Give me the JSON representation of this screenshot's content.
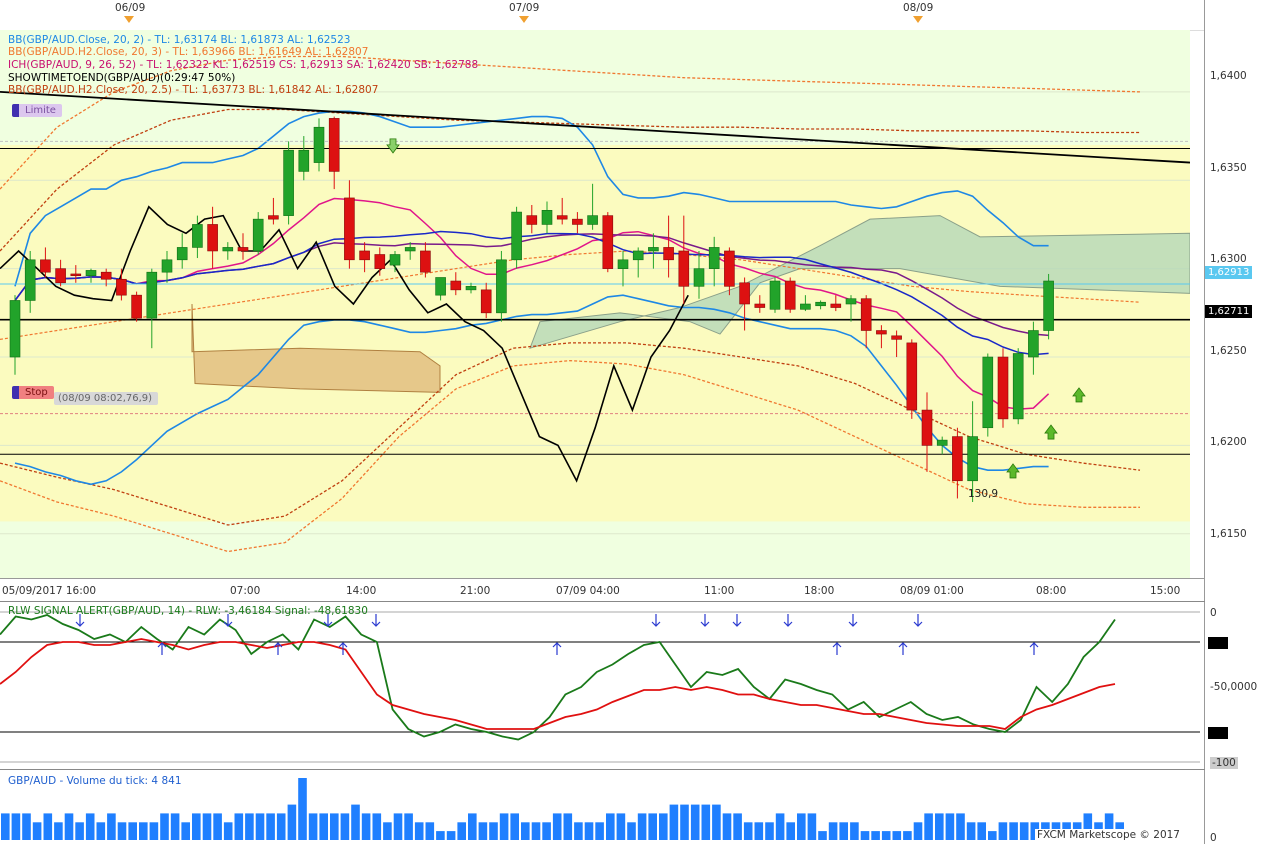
{
  "colors": {
    "bg_pane": "#f0ffe0",
    "band_yellow": "#fbfbbf",
    "up": "#22a32a",
    "down": "#dd1111",
    "bb_blue": "#1e88e5",
    "bb_orange": "#f07830",
    "bb_darkorange": "#c04010",
    "ich_mag": "#e0158a",
    "ich_purple": "#7a1a8a",
    "ich_blue": "#1a28c8",
    "kumo_green": "#b8d9b8",
    "kumo_orange": "#e6c88a",
    "showtime_black": "#000000",
    "rlw_green": "#1a7a1a",
    "rlw_red": "#e01010",
    "vol_blue": "#1f7fff"
  },
  "header_dates": [
    "06/09",
    "07/09",
    "08/09"
  ],
  "legend": [
    {
      "text": "BB(GBP/AUD.Close, 20, 2) -  TL: 1,63174  BL: 1,61873  AL: 1,62523",
      "color": "#1e88e5"
    },
    {
      "text": "BB(GBP/AUD.H2.Close, 20, 3) -  TL: 1,63966  BL: 1,61649  AL: 1,62807",
      "color": "#f07830"
    },
    {
      "text": "ICH(GBP/AUD, 9, 26, 52) -  TL: 1,62322  KL: 1,62519  CS: 1,62913  SA: 1,62420  SB: 1,62788",
      "color": "#c81070"
    },
    {
      "text": "SHOWTIMETOEND(GBP/AUD)(0:29:47 50%)",
      "color": "#000000"
    },
    {
      "text": "BB(GBP/AUD.H2.Close, 20, 2.5) -  TL: 1,63773  BL: 1,61842  AL: 1,62807",
      "color": "#c04010"
    }
  ],
  "badges": {
    "limite": "Limite",
    "stop": "Stop",
    "stop_note": "(08/09 08:02,76,9)"
  },
  "annotation_value": "130,9",
  "price_axis": [
    "1,6400",
    "1,6350",
    "1,6300",
    "1,6250",
    "1,6200",
    "1,6150"
  ],
  "price_boxes": {
    "current": "1,62913",
    "line": "1,62711"
  },
  "time_axis": [
    "05/09/2017 16:00",
    "07:00",
    "14:00",
    "21:00",
    "07/09 04:00",
    "11:00",
    "18:00",
    "08/09 01:00",
    "08:00",
    "15:00"
  ],
  "rlw": {
    "title": "RLW SIGNAL ALERT(GBP/AUD, 14) -  RLW: -3,46184  Signal: -48,61830",
    "axis": [
      "0",
      "-50,0000",
      "-100"
    ]
  },
  "volume": {
    "title": "GBP/AUD - Volume du tick: 4 841",
    "axis": [
      "0"
    ]
  },
  "copyright": "FXCM Marketscope © 2017",
  "chart_data": [
    {
      "type": "candlestick",
      "title": "GBP/AUD",
      "ylim": [
        1.6125,
        1.6435
      ],
      "x_tick_labels": [
        "05/09/2017 16:00",
        "07:00",
        "14:00",
        "21:00",
        "07/09 04:00",
        "11:00",
        "18:00",
        "08/09 01:00",
        "08:00",
        "15:00"
      ],
      "candles": [
        {
          "o": 1.625,
          "h": 1.6285,
          "l": 1.624,
          "c": 1.6282
        },
        {
          "o": 1.6282,
          "h": 1.631,
          "l": 1.6275,
          "c": 1.6305
        },
        {
          "o": 1.6305,
          "h": 1.6312,
          "l": 1.6295,
          "c": 1.6298
        },
        {
          "o": 1.63,
          "h": 1.6305,
          "l": 1.629,
          "c": 1.6292
        },
        {
          "o": 1.6297,
          "h": 1.6302,
          "l": 1.6292,
          "c": 1.6296
        },
        {
          "o": 1.6296,
          "h": 1.63,
          "l": 1.6292,
          "c": 1.6299
        },
        {
          "o": 1.6298,
          "h": 1.63,
          "l": 1.629,
          "c": 1.6294
        },
        {
          "o": 1.6294,
          "h": 1.63,
          "l": 1.6282,
          "c": 1.6285
        },
        {
          "o": 1.6285,
          "h": 1.6287,
          "l": 1.627,
          "c": 1.6272
        },
        {
          "o": 1.6272,
          "h": 1.63,
          "l": 1.6255,
          "c": 1.6298
        },
        {
          "o": 1.6298,
          "h": 1.631,
          "l": 1.6292,
          "c": 1.6305
        },
        {
          "o": 1.6305,
          "h": 1.632,
          "l": 1.63,
          "c": 1.6312
        },
        {
          "o": 1.6312,
          "h": 1.633,
          "l": 1.6306,
          "c": 1.6325
        },
        {
          "o": 1.6325,
          "h": 1.6335,
          "l": 1.63,
          "c": 1.631
        },
        {
          "o": 1.631,
          "h": 1.6315,
          "l": 1.6305,
          "c": 1.6312
        },
        {
          "o": 1.6312,
          "h": 1.632,
          "l": 1.6305,
          "c": 1.631
        },
        {
          "o": 1.631,
          "h": 1.6332,
          "l": 1.6308,
          "c": 1.6328
        },
        {
          "o": 1.633,
          "h": 1.634,
          "l": 1.6325,
          "c": 1.6328
        },
        {
          "o": 1.633,
          "h": 1.6372,
          "l": 1.6325,
          "c": 1.6367
        },
        {
          "o": 1.6355,
          "h": 1.6375,
          "l": 1.635,
          "c": 1.6367
        },
        {
          "o": 1.636,
          "h": 1.6385,
          "l": 1.6355,
          "c": 1.638
        },
        {
          "o": 1.6385,
          "h": 1.6386,
          "l": 1.6345,
          "c": 1.6355
        },
        {
          "o": 1.634,
          "h": 1.635,
          "l": 1.63,
          "c": 1.6305
        },
        {
          "o": 1.631,
          "h": 1.6315,
          "l": 1.6298,
          "c": 1.6305
        },
        {
          "o": 1.6308,
          "h": 1.6312,
          "l": 1.6296,
          "c": 1.63
        },
        {
          "o": 1.6302,
          "h": 1.631,
          "l": 1.6298,
          "c": 1.6308
        },
        {
          "o": 1.631,
          "h": 1.6315,
          "l": 1.6305,
          "c": 1.6312
        },
        {
          "o": 1.631,
          "h": 1.6315,
          "l": 1.6295,
          "c": 1.6298
        },
        {
          "o": 1.6285,
          "h": 1.6295,
          "l": 1.6282,
          "c": 1.6295
        },
        {
          "o": 1.6293,
          "h": 1.6298,
          "l": 1.6285,
          "c": 1.6288
        },
        {
          "o": 1.6288,
          "h": 1.6292,
          "l": 1.6286,
          "c": 1.629
        },
        {
          "o": 1.6288,
          "h": 1.6292,
          "l": 1.6272,
          "c": 1.6275
        },
        {
          "o": 1.6275,
          "h": 1.631,
          "l": 1.627,
          "c": 1.6305
        },
        {
          "o": 1.6305,
          "h": 1.6335,
          "l": 1.63,
          "c": 1.6332
        },
        {
          "o": 1.633,
          "h": 1.6336,
          "l": 1.632,
          "c": 1.6325
        },
        {
          "o": 1.6325,
          "h": 1.6338,
          "l": 1.632,
          "c": 1.6333
        },
        {
          "o": 1.633,
          "h": 1.634,
          "l": 1.6325,
          "c": 1.6328
        },
        {
          "o": 1.6328,
          "h": 1.6332,
          "l": 1.632,
          "c": 1.6325
        },
        {
          "o": 1.6325,
          "h": 1.6348,
          "l": 1.6322,
          "c": 1.633
        },
        {
          "o": 1.633,
          "h": 1.6332,
          "l": 1.6298,
          "c": 1.63
        },
        {
          "o": 1.63,
          "h": 1.631,
          "l": 1.629,
          "c": 1.6305
        },
        {
          "o": 1.6305,
          "h": 1.6312,
          "l": 1.6295,
          "c": 1.631
        },
        {
          "o": 1.631,
          "h": 1.632,
          "l": 1.63,
          "c": 1.6312
        },
        {
          "o": 1.6312,
          "h": 1.633,
          "l": 1.6295,
          "c": 1.6305
        },
        {
          "o": 1.631,
          "h": 1.633,
          "l": 1.628,
          "c": 1.629
        },
        {
          "o": 1.629,
          "h": 1.631,
          "l": 1.6283,
          "c": 1.63
        },
        {
          "o": 1.63,
          "h": 1.6318,
          "l": 1.629,
          "c": 1.6312
        },
        {
          "o": 1.631,
          "h": 1.6312,
          "l": 1.6285,
          "c": 1.629
        },
        {
          "o": 1.6292,
          "h": 1.6295,
          "l": 1.6265,
          "c": 1.628
        },
        {
          "o": 1.628,
          "h": 1.6285,
          "l": 1.6275,
          "c": 1.6278
        },
        {
          "o": 1.6277,
          "h": 1.6295,
          "l": 1.6275,
          "c": 1.6293
        },
        {
          "o": 1.6293,
          "h": 1.6295,
          "l": 1.6275,
          "c": 1.6277
        },
        {
          "o": 1.6277,
          "h": 1.6285,
          "l": 1.6276,
          "c": 1.628
        },
        {
          "o": 1.6279,
          "h": 1.6282,
          "l": 1.6277,
          "c": 1.6281
        },
        {
          "o": 1.628,
          "h": 1.6285,
          "l": 1.6276,
          "c": 1.6278
        },
        {
          "o": 1.628,
          "h": 1.6285,
          "l": 1.627,
          "c": 1.6283
        },
        {
          "o": 1.6283,
          "h": 1.6285,
          "l": 1.6255,
          "c": 1.6265
        },
        {
          "o": 1.6265,
          "h": 1.6268,
          "l": 1.6255,
          "c": 1.6263
        },
        {
          "o": 1.6262,
          "h": 1.6265,
          "l": 1.625,
          "c": 1.626
        },
        {
          "o": 1.6258,
          "h": 1.626,
          "l": 1.6215,
          "c": 1.622
        },
        {
          "o": 1.622,
          "h": 1.623,
          "l": 1.6185,
          "c": 1.62
        },
        {
          "o": 1.62,
          "h": 1.6205,
          "l": 1.6195,
          "c": 1.6203
        },
        {
          "o": 1.6205,
          "h": 1.621,
          "l": 1.617,
          "c": 1.618
        },
        {
          "o": 1.618,
          "h": 1.6225,
          "l": 1.6168,
          "c": 1.6205
        },
        {
          "o": 1.621,
          "h": 1.6252,
          "l": 1.6205,
          "c": 1.625
        },
        {
          "o": 1.625,
          "h": 1.6255,
          "l": 1.621,
          "c": 1.6215
        },
        {
          "o": 1.6215,
          "h": 1.6255,
          "l": 1.6212,
          "c": 1.6252
        },
        {
          "o": 1.625,
          "h": 1.627,
          "l": 1.624,
          "c": 1.6265
        },
        {
          "o": 1.6265,
          "h": 1.6297,
          "l": 1.626,
          "c": 1.6293
        }
      ],
      "bb_20_2": {
        "upper": [
          1.629,
          1.632,
          1.633,
          1.6335,
          1.634,
          1.6345,
          1.6345,
          1.635,
          1.6352,
          1.6355,
          1.6357,
          1.636,
          1.636,
          1.636,
          1.6362,
          1.6364,
          1.6368,
          1.6375,
          1.6382,
          1.6386,
          1.6388,
          1.6389,
          1.6389,
          1.6388,
          1.6386,
          1.6383,
          1.638,
          1.638,
          1.638,
          1.6381,
          1.6382,
          1.6383,
          1.6384,
          1.6385,
          1.6386,
          1.6386,
          1.6385,
          1.638,
          1.637,
          1.6352,
          1.6342,
          1.634,
          1.634,
          1.6341,
          1.6343,
          1.6342,
          1.634,
          1.6338,
          1.6338,
          1.6338,
          1.6338,
          1.6338,
          1.6338,
          1.6338,
          1.6338,
          1.6336,
          1.6335,
          1.6334,
          1.6335,
          1.6338,
          1.6341,
          1.6343,
          1.6344,
          1.6341,
          1.6333,
          1.6326,
          1.6318,
          1.6313,
          1.6313
        ],
        "lower": [
          1.619,
          1.6188,
          1.6185,
          1.6183,
          1.618,
          1.6178,
          1.618,
          1.6185,
          1.6192,
          1.62,
          1.6208,
          1.6213,
          1.6218,
          1.6222,
          1.6226,
          1.6233,
          1.624,
          1.625,
          1.626,
          1.6268,
          1.627,
          1.6271,
          1.6271,
          1.627,
          1.6268,
          1.6266,
          1.6264,
          1.6264,
          1.6265,
          1.6266,
          1.6268,
          1.6269,
          1.6271,
          1.6273,
          1.6274,
          1.6274,
          1.6275,
          1.6276,
          1.628,
          1.6284,
          1.6285,
          1.6283,
          1.6281,
          1.6279,
          1.6278,
          1.6278,
          1.6277,
          1.6275,
          1.6272,
          1.627,
          1.6268,
          1.6266,
          1.6266,
          1.6266,
          1.6265,
          1.6262,
          1.6256,
          1.6245,
          1.6234,
          1.6222,
          1.621,
          1.62,
          1.6193,
          1.6188,
          1.6186,
          1.6186,
          1.6187,
          1.6188,
          1.6188
        ]
      },
      "showtime_line": [
        1.63,
        1.631,
        1.63,
        1.629,
        1.6285,
        1.6283,
        1.6282,
        1.631,
        1.6335,
        1.6325,
        1.632,
        1.6328,
        1.633,
        1.631,
        1.631,
        1.6322,
        1.63,
        1.6315,
        1.629,
        1.628,
        1.6295,
        1.6305,
        1.6288,
        1.6275,
        1.628,
        1.627,
        1.6265,
        1.6255,
        1.623,
        1.6205,
        1.62,
        1.618,
        1.621,
        1.6245,
        1.622,
        1.625,
        1.6265,
        1.6285
      ]
    },
    {
      "type": "line",
      "title": "RLW SIGNAL ALERT(GBP/AUD, 14)",
      "ylim": [
        -100,
        0
      ],
      "series": [
        {
          "name": "RLW",
          "values": [
            -15,
            -3,
            -5,
            -2,
            -8,
            -12,
            -18,
            -15,
            -20,
            -10,
            -18,
            -25,
            -10,
            -15,
            -5,
            -12,
            -28,
            -20,
            -15,
            -25,
            -5,
            -10,
            -3,
            -15,
            -20,
            -65,
            -78,
            -83,
            -80,
            -75,
            -78,
            -80,
            -83,
            -85,
            -80,
            -70,
            -55,
            -50,
            -40,
            -35,
            -28,
            -22,
            -20,
            -35,
            -50,
            -40,
            -42,
            -38,
            -50,
            -58,
            -45,
            -48,
            -52,
            -55,
            -65,
            -60,
            -70,
            -65,
            -60,
            -68,
            -72,
            -70,
            -75,
            -78,
            -80,
            -72,
            -50,
            -60,
            -48,
            -30,
            -20,
            -5
          ]
        },
        {
          "name": "Signal",
          "values": [
            -48,
            -40,
            -30,
            -22,
            -20,
            -20,
            -22,
            -22,
            -20,
            -18,
            -20,
            -22,
            -25,
            -22,
            -20,
            -20,
            -22,
            -24,
            -22,
            -20,
            -20,
            -22,
            -25,
            -40,
            -55,
            -62,
            -65,
            -68,
            -70,
            -72,
            -75,
            -78,
            -78,
            -78,
            -78,
            -74,
            -70,
            -68,
            -65,
            -60,
            -56,
            -52,
            -52,
            -50,
            -52,
            -50,
            -52,
            -55,
            -55,
            -58,
            -60,
            -62,
            -62,
            -64,
            -66,
            -68,
            -68,
            -70,
            -72,
            -74,
            -75,
            -76,
            -76,
            -76,
            -78,
            -70,
            -65,
            -62,
            -58,
            -54,
            -50,
            -48
          ]
        }
      ]
    },
    {
      "type": "bar",
      "title": "GBP/AUD - Volume du tick",
      "values": [
        3,
        3,
        3,
        2,
        3,
        2,
        3,
        2,
        3,
        2,
        3,
        2,
        2,
        2,
        2,
        3,
        3,
        2,
        3,
        3,
        3,
        2,
        3,
        3,
        3,
        3,
        3,
        4,
        7,
        3,
        3,
        3,
        3,
        4,
        3,
        3,
        2,
        3,
        3,
        2,
        2,
        1,
        1,
        2,
        3,
        2,
        2,
        3,
        3,
        2,
        2,
        2,
        3,
        3,
        2,
        2,
        2,
        3,
        3,
        2,
        3,
        3,
        3,
        4,
        4,
        4,
        4,
        4,
        3,
        3,
        2,
        2,
        2,
        3,
        2,
        3,
        3,
        1,
        2,
        2,
        2,
        1,
        1,
        1,
        1,
        1,
        2,
        3,
        3,
        3,
        3,
        2,
        2,
        1,
        2,
        2,
        2,
        2,
        2,
        2,
        2,
        2,
        3,
        2,
        3,
        2
      ]
    }
  ]
}
